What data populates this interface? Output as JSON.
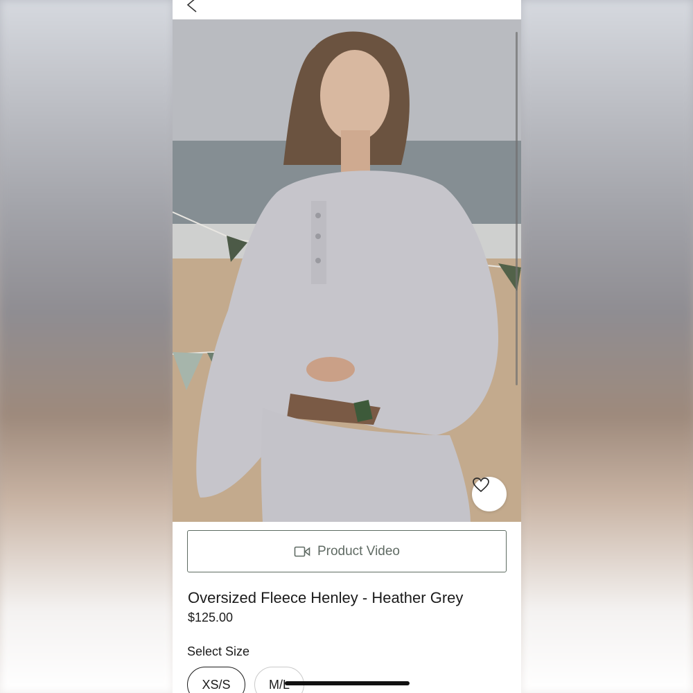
{
  "product": {
    "title": "Oversized Fleece Henley - Heather Grey",
    "price": "$125.00",
    "video_label": "Product Video"
  },
  "size_selector": {
    "label": "Select Size",
    "options": [
      "XS/S",
      "M/L"
    ],
    "selected": "XS/S"
  },
  "icons": {
    "back": "chevron-left-icon",
    "favorite": "heart-icon",
    "video": "video-camera-icon"
  },
  "colors": {
    "accent": "#5d6b61",
    "text": "#1b1b1b"
  }
}
